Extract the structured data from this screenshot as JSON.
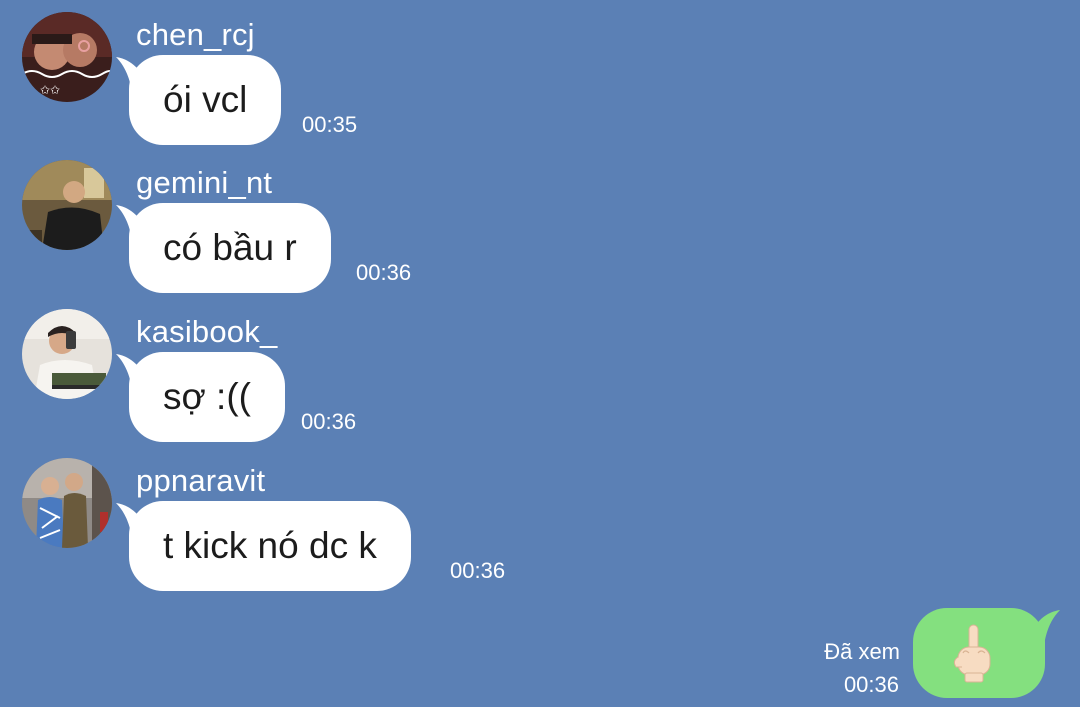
{
  "colors": {
    "background": "#5b80b5",
    "incoming_bubble": "#ffffff",
    "outgoing_bubble": "#84e07f",
    "meta_text": "#ffffff"
  },
  "messages": [
    {
      "username": "chen_rcj",
      "text": "ói vcl",
      "time": "00:35",
      "avatar": "user-avatar-chen-rcj"
    },
    {
      "username": "gemini_nt",
      "text": "có bầu r",
      "time": "00:36",
      "avatar": "user-avatar-gemini-nt"
    },
    {
      "username": "kasibook_",
      "text": "sợ :((",
      "time": "00:36",
      "avatar": "user-avatar-kasibook"
    },
    {
      "username": "ppnaravit",
      "text": "t kick nó dc k",
      "time": "00:36",
      "avatar": "user-avatar-ppnaravit"
    }
  ],
  "sent_message": {
    "content_icon": "middle-finger-emoji-icon",
    "read_status": "Đã xem",
    "time": "00:36"
  }
}
